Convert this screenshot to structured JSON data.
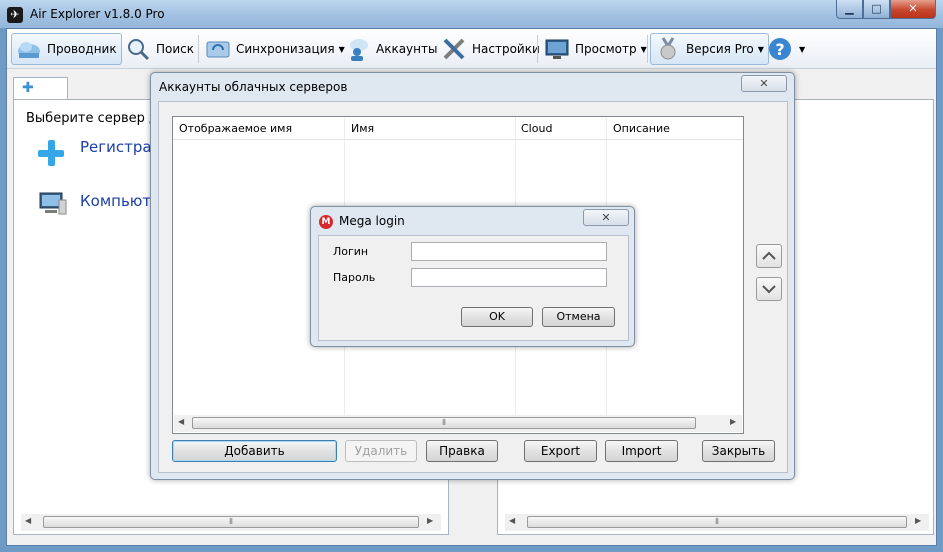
{
  "window": {
    "title": "Air Explorer v1.8.0 Pro"
  },
  "toolbar": {
    "explorer": "Проводник",
    "search": "Поиск",
    "sync": "Синхронизация",
    "accounts": "Аккаунты",
    "settings": "Настройки",
    "view": "Просмотр",
    "version": "Версия Pro"
  },
  "left_pane": {
    "prompt": "Выберите сервер д",
    "register": "Регистрац",
    "computer": "Компьюте"
  },
  "accounts_dialog": {
    "title": "Аккаунты облачных серверов",
    "columns": [
      "Отображаемое имя",
      "Имя",
      "Cloud",
      "Описание"
    ],
    "buttons": {
      "add": "Добавить",
      "delete": "Удалить",
      "edit": "Правка",
      "export": "Export",
      "import": "Import",
      "close": "Закрыть"
    }
  },
  "mega_dialog": {
    "title": "Mega login",
    "login_label": "Логин",
    "password_label": "Пароль",
    "login_value": "",
    "password_value": "",
    "ok": "OK",
    "cancel": "Отмена"
  },
  "colors": {
    "title_gradient": "#a6c4e3",
    "close_red": "#c7472e",
    "link_blue": "#1c3fa8",
    "mega_red": "#d9272e"
  }
}
